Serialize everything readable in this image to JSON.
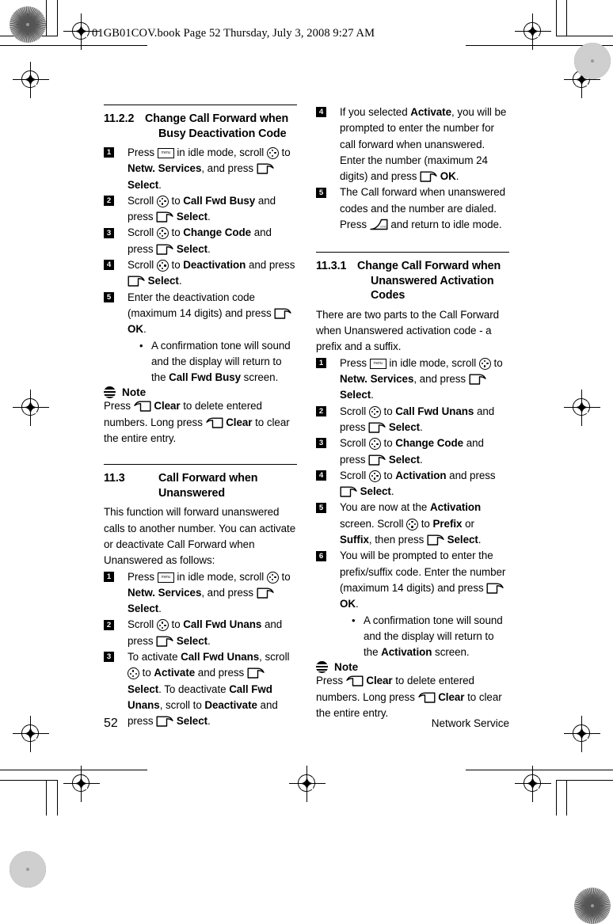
{
  "header": {
    "file_line": "01GB01COV.book  Page 52  Thursday, July 3, 2008  9:27 AM"
  },
  "footer": {
    "page_number": "52",
    "section_name": "Network Service"
  },
  "icons": {
    "menu_key": "menu-key-icon",
    "nav_key": "navigation-scroll-key-icon",
    "soft_key": "left-soft-key-icon",
    "clear_key": "right-soft-clear-key-icon",
    "end_key": "end-call-key-icon",
    "note": "note-icon"
  },
  "left_column": {
    "section_11_2_2": {
      "number": "11.2.2",
      "title_line1": "Change Call Forward when",
      "title_line2": "Busy Deactivation Code",
      "steps": [
        {
          "n": "1",
          "parts": [
            {
              "t": "Press "
            },
            {
              "icon": "menu"
            },
            {
              "t": " in idle mode, scroll "
            },
            {
              "icon": "nav"
            },
            {
              "t": " to "
            },
            {
              "b": "Netw. Services"
            },
            {
              "t": ", and press "
            },
            {
              "icon": "soft"
            },
            {
              "t": " "
            },
            {
              "b": "Select"
            },
            {
              "t": "."
            }
          ]
        },
        {
          "n": "2",
          "parts": [
            {
              "t": "Scroll "
            },
            {
              "icon": "nav"
            },
            {
              "t": " to "
            },
            {
              "b": "Call Fwd Busy"
            },
            {
              "t": " and press "
            },
            {
              "icon": "soft"
            },
            {
              "t": " "
            },
            {
              "b": "Select"
            },
            {
              "t": "."
            }
          ]
        },
        {
          "n": "3",
          "parts": [
            {
              "t": "Scroll "
            },
            {
              "icon": "nav"
            },
            {
              "t": " to "
            },
            {
              "b": "Change Code"
            },
            {
              "t": " and press "
            },
            {
              "icon": "soft"
            },
            {
              "t": " "
            },
            {
              "b": "Select"
            },
            {
              "t": "."
            }
          ]
        },
        {
          "n": "4",
          "parts": [
            {
              "t": "Scroll "
            },
            {
              "icon": "nav"
            },
            {
              "t": " to "
            },
            {
              "b": "Deactivation"
            },
            {
              "t": " and press "
            },
            {
              "icon": "soft"
            },
            {
              "t": " "
            },
            {
              "b": "Select"
            },
            {
              "t": "."
            }
          ]
        },
        {
          "n": "5",
          "parts": [
            {
              "t": "Enter the deactivation code (maximum 14 digits) and press "
            },
            {
              "icon": "soft"
            },
            {
              "t": " "
            },
            {
              "b": "OK"
            },
            {
              "t": "."
            }
          ],
          "bullets": [
            [
              {
                "t": "A confirmation tone will sound and the display will return to the "
              },
              {
                "b": "Call Fwd Busy"
              },
              {
                "t": " screen."
              }
            ]
          ]
        }
      ],
      "note": {
        "label": "Note",
        "parts": [
          {
            "t": "Press "
          },
          {
            "icon": "clear"
          },
          {
            "t": " "
          },
          {
            "b": "Clear"
          },
          {
            "t": " to delete entered numbers. Long press "
          },
          {
            "icon": "clear"
          },
          {
            "t": " "
          },
          {
            "b": "Clear"
          },
          {
            "t": " to clear the entire entry."
          }
        ]
      }
    },
    "section_11_3": {
      "number": "11.3",
      "title_line1": "Call Forward when",
      "title_line2": "Unanswered",
      "intro": "This function will forward unanswered calls to another number. You can activate or deactivate Call Forward when Unanswered as follows:",
      "steps": [
        {
          "n": "1",
          "parts": [
            {
              "t": "Press "
            },
            {
              "icon": "menu"
            },
            {
              "t": " in idle mode, scroll "
            },
            {
              "icon": "nav"
            },
            {
              "t": " to "
            },
            {
              "b": "Netw. Services"
            },
            {
              "t": ", and press "
            },
            {
              "icon": "soft"
            },
            {
              "t": " "
            },
            {
              "b": "Select"
            },
            {
              "t": "."
            }
          ]
        },
        {
          "n": "2",
          "parts": [
            {
              "t": "Scroll "
            },
            {
              "icon": "nav"
            },
            {
              "t": " to "
            },
            {
              "b": "Call Fwd Unans"
            },
            {
              "t": " and press "
            },
            {
              "icon": "soft"
            },
            {
              "t": " "
            },
            {
              "b": "Select"
            },
            {
              "t": "."
            }
          ]
        },
        {
          "n": "3",
          "parts": [
            {
              "t": "To activate "
            },
            {
              "b": "Call Fwd Unans"
            },
            {
              "t": ", scroll "
            },
            {
              "icon": "nav"
            },
            {
              "t": " to "
            },
            {
              "b": "Activate"
            },
            {
              "t": " and press "
            },
            {
              "icon": "soft"
            },
            {
              "t": " "
            },
            {
              "b": "Select"
            },
            {
              "t": ". To deactivate "
            },
            {
              "b": "Call Fwd Unans"
            },
            {
              "t": ", scroll to "
            },
            {
              "b": "Deactivate"
            },
            {
              "t": " and press "
            },
            {
              "icon": "soft"
            },
            {
              "t": " "
            },
            {
              "b": "Select"
            },
            {
              "t": "."
            }
          ]
        }
      ]
    }
  },
  "right_column": {
    "continued_steps": [
      {
        "n": "4",
        "parts": [
          {
            "t": "If you selected "
          },
          {
            "b": "Activate"
          },
          {
            "t": ", you will be prompted to enter the number for call forward when unanswered. Enter the number (maximum 24 digits) and press "
          },
          {
            "icon": "soft"
          },
          {
            "t": " "
          },
          {
            "b": "OK"
          },
          {
            "t": "."
          }
        ]
      },
      {
        "n": "5",
        "parts": [
          {
            "t": "The Call forward when unanswered codes and the number are dialed. Press "
          },
          {
            "icon": "end"
          },
          {
            "t": " and return to idle mode."
          }
        ]
      }
    ],
    "section_11_3_1": {
      "number": "11.3.1",
      "title_line1": "Change Call Forward when",
      "title_line2": "Unanswered Activation",
      "title_line3": "Codes",
      "intro": "There are two parts to the Call Forward when Unanswered activation code - a prefix and a suffix.",
      "steps": [
        {
          "n": "1",
          "parts": [
            {
              "t": "Press "
            },
            {
              "icon": "menu"
            },
            {
              "t": " in idle mode, scroll "
            },
            {
              "icon": "nav"
            },
            {
              "t": " to "
            },
            {
              "b": "Netw. Services"
            },
            {
              "t": ", and press "
            },
            {
              "icon": "soft"
            },
            {
              "t": " "
            },
            {
              "b": "Select"
            },
            {
              "t": "."
            }
          ]
        },
        {
          "n": "2",
          "parts": [
            {
              "t": "Scroll "
            },
            {
              "icon": "nav"
            },
            {
              "t": " to "
            },
            {
              "b": "Call Fwd Unans"
            },
            {
              "t": " and press "
            },
            {
              "icon": "soft"
            },
            {
              "t": " "
            },
            {
              "b": "Select"
            },
            {
              "t": "."
            }
          ]
        },
        {
          "n": "3",
          "parts": [
            {
              "t": "Scroll "
            },
            {
              "icon": "nav"
            },
            {
              "t": " to "
            },
            {
              "b": "Change Code"
            },
            {
              "t": " and press "
            },
            {
              "icon": "soft"
            },
            {
              "t": " "
            },
            {
              "b": "Select"
            },
            {
              "t": "."
            }
          ]
        },
        {
          "n": "4",
          "parts": [
            {
              "t": "Scroll "
            },
            {
              "icon": "nav"
            },
            {
              "t": " to "
            },
            {
              "b": "Activation"
            },
            {
              "t": " and press "
            },
            {
              "icon": "soft"
            },
            {
              "t": " "
            },
            {
              "b": "Select"
            },
            {
              "t": "."
            }
          ]
        },
        {
          "n": "5",
          "parts": [
            {
              "t": "You are now at the "
            },
            {
              "b": "Activation"
            },
            {
              "t": " screen. Scroll "
            },
            {
              "icon": "nav"
            },
            {
              "t": " to "
            },
            {
              "b": "Prefix"
            },
            {
              "t": " or "
            },
            {
              "b": "Suffix"
            },
            {
              "t": ", then press "
            },
            {
              "icon": "soft"
            },
            {
              "t": " "
            },
            {
              "b": "Select"
            },
            {
              "t": "."
            }
          ]
        },
        {
          "n": "6",
          "parts": [
            {
              "t": "You will be prompted to enter the prefix/suffix code. Enter the number (maximum 14 digits) and press "
            },
            {
              "icon": "soft"
            },
            {
              "t": " "
            },
            {
              "b": "OK"
            },
            {
              "t": "."
            }
          ],
          "bullets": [
            [
              {
                "t": "A confirmation tone will sound and the display will return to the "
              },
              {
                "b": "Activation"
              },
              {
                "t": " screen."
              }
            ]
          ]
        }
      ],
      "note": {
        "label": "Note",
        "parts": [
          {
            "t": "Press "
          },
          {
            "icon": "clear"
          },
          {
            "t": " "
          },
          {
            "b": "Clear"
          },
          {
            "t": " to delete entered numbers. Long press "
          },
          {
            "icon": "clear"
          },
          {
            "t": " "
          },
          {
            "b": "Clear"
          },
          {
            "t": " to clear the entire entry."
          }
        ]
      }
    }
  }
}
